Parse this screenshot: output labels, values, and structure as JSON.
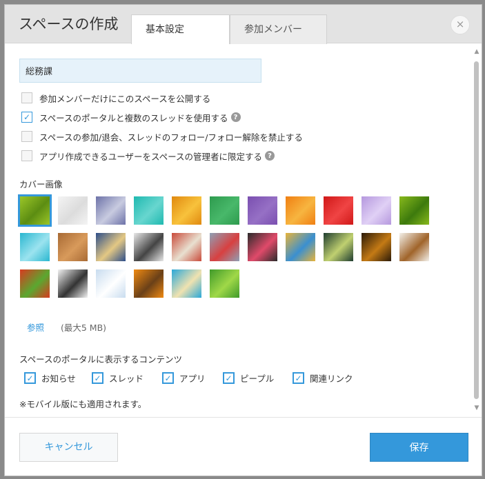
{
  "dialog": {
    "title": "スペースの作成",
    "tabs": [
      {
        "label": "基本設定",
        "active": true
      },
      {
        "label": "参加メンバー",
        "active": false
      }
    ],
    "close_icon": "×"
  },
  "form": {
    "space_name_value": "総務課",
    "options": [
      {
        "label": "参加メンバーだけにこのスペースを公開する",
        "checked": false,
        "help": false
      },
      {
        "label": "スペースのポータルと複数のスレッドを使用する",
        "checked": true,
        "help": true
      },
      {
        "label": "スペースの参加/退会、スレッドのフォロー/フォロー解除を禁止する",
        "checked": false,
        "help": false
      },
      {
        "label": "アプリ作成できるユーザーをスペースの管理者に限定する",
        "checked": false,
        "help": true
      }
    ],
    "help_icon_glyph": "?",
    "check_glyph": "✓"
  },
  "cover": {
    "label": "カバー画像",
    "selected_index": 0,
    "images": [
      {
        "name": "green-abstract",
        "colors": [
          "#9bc628",
          "#5c8d12"
        ]
      },
      {
        "name": "white-geometric",
        "colors": [
          "#f4f4f4",
          "#dcdcdc"
        ]
      },
      {
        "name": "blue-gradient",
        "colors": [
          "#6d72a8",
          "#c8cbe0"
        ]
      },
      {
        "name": "teal-water",
        "colors": [
          "#1fb9b0",
          "#68d6cf"
        ]
      },
      {
        "name": "orange-texture",
        "colors": [
          "#e0890f",
          "#f8c23c"
        ]
      },
      {
        "name": "green-paper",
        "colors": [
          "#2e9b4e",
          "#48b86a"
        ]
      },
      {
        "name": "purple-paper",
        "colors": [
          "#7a4fb0",
          "#9670c5"
        ]
      },
      {
        "name": "orange-flowers",
        "colors": [
          "#f07f12",
          "#f7b540"
        ]
      },
      {
        "name": "red-rose",
        "colors": [
          "#d01818",
          "#f04444"
        ]
      },
      {
        "name": "lilac-flower",
        "colors": [
          "#b598de",
          "#e0d0f5"
        ]
      },
      {
        "name": "green-leaf",
        "colors": [
          "#88b91c",
          "#3d7a0d"
        ]
      },
      {
        "name": "teal-blocks",
        "colors": [
          "#2ab7d0",
          "#9be3ef"
        ]
      },
      {
        "name": "wood-parquet",
        "colors": [
          "#a86a34",
          "#d89a5b"
        ]
      },
      {
        "name": "mosaic-tiles",
        "colors": [
          "#2d4e8a",
          "#e4c884"
        ]
      },
      {
        "name": "compass",
        "colors": [
          "#e8e8e8",
          "#444444"
        ]
      },
      {
        "name": "books-stack",
        "colors": [
          "#c94a3a",
          "#e8e0d0"
        ]
      },
      {
        "name": "desk-items",
        "colors": [
          "#8fa0b5",
          "#d84040"
        ]
      },
      {
        "name": "chalkboard-doodles",
        "colors": [
          "#2b2b2b",
          "#e04a6a"
        ]
      },
      {
        "name": "colored-pencils",
        "colors": [
          "#e8b43a",
          "#3a8fd0"
        ]
      },
      {
        "name": "lightbulb-sketch",
        "colors": [
          "#1f3d30",
          "#c0d070"
        ]
      },
      {
        "name": "dark-bokeh",
        "colors": [
          "#2b1a08",
          "#c47a15"
        ]
      },
      {
        "name": "latte-art",
        "colors": [
          "#f3f0ea",
          "#a0642a"
        ]
      },
      {
        "name": "vegetables",
        "colors": [
          "#d83a20",
          "#5aa830"
        ]
      },
      {
        "name": "cat-peeking",
        "colors": [
          "#f2f2f2",
          "#333333"
        ]
      },
      {
        "name": "snowy-trees",
        "colors": [
          "#c8dcef",
          "#ffffff"
        ]
      },
      {
        "name": "oranges",
        "colors": [
          "#f08a12",
          "#6a4018"
        ]
      },
      {
        "name": "tropical-beach",
        "colors": [
          "#2aa8d8",
          "#f0e2b0"
        ]
      },
      {
        "name": "bamboo",
        "colors": [
          "#3f9a2a",
          "#a0d848"
        ]
      }
    ],
    "browse_label": "参照",
    "max_size_label": "(最大5 MB)"
  },
  "portal": {
    "label": "スペースのポータルに表示するコンテンツ",
    "items": [
      {
        "label": "お知らせ",
        "checked": true
      },
      {
        "label": "スレッド",
        "checked": true
      },
      {
        "label": "アプリ",
        "checked": true
      },
      {
        "label": "ピープル",
        "checked": true
      },
      {
        "label": "関連リンク",
        "checked": true
      }
    ],
    "note": "※モバイル版にも適用されます。"
  },
  "footer": {
    "cancel_label": "キャンセル",
    "save_label": "保存"
  },
  "colors": {
    "accent": "#3498db",
    "header_bg": "#e3e3e3",
    "input_bg": "#e6f2fa"
  }
}
